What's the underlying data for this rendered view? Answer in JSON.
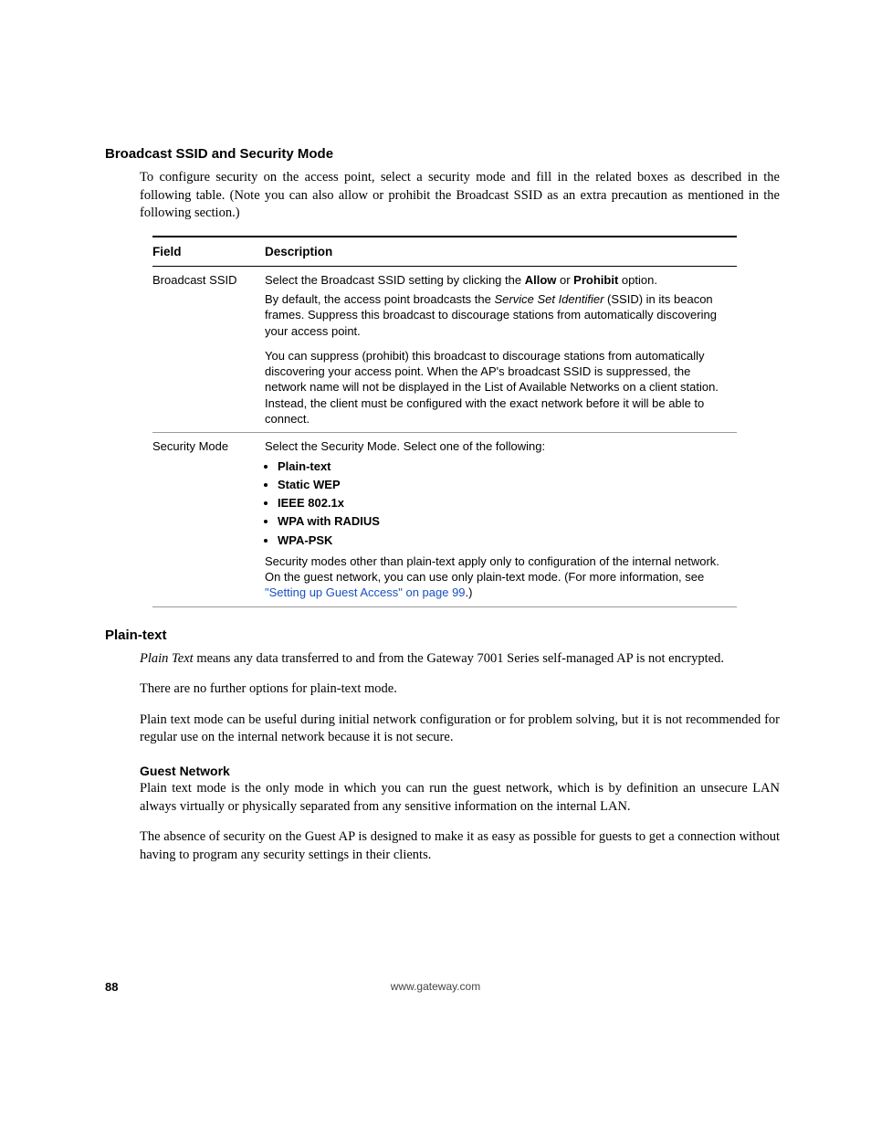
{
  "headings": {
    "h1": "Broadcast SSID and Security Mode",
    "h2": "Plain-text",
    "h3": "Guest Network"
  },
  "intro": {
    "p1": "To configure security on the access point, select a security mode and fill in the related boxes as described in the following table. (Note you can also allow or prohibit the Broadcast SSID as an extra precaution as mentioned in the following section.)"
  },
  "table": {
    "headers": {
      "field": "Field",
      "description": "Description"
    },
    "rows": {
      "broadcast_ssid": {
        "field": "Broadcast SSID",
        "line1_a": "Select the Broadcast SSID setting by clicking the ",
        "line1_allow": "Allow",
        "line1_b": " or ",
        "line1_prohibit": "Prohibit",
        "line1_c": " option.",
        "line2_a": "By default, the access point broadcasts the ",
        "line2_ssi": "Service Set Identifier",
        "line2_b": " (SSID) in its beacon frames. Suppress this broadcast to discourage stations from automatically discovering your access point.",
        "line3": "You can suppress (prohibit) this broadcast to discourage stations from automatically discovering your access point. When the AP's broadcast SSID is suppressed, the network name will not be displayed in the List of Available Networks on a client station. Instead, the client must be configured with the exact network before it will be able to connect."
      },
      "security_mode": {
        "field": "Security Mode",
        "line1": "Select the Security Mode. Select one of the following:",
        "modes": [
          "Plain-text",
          "Static WEP",
          "IEEE 802.1x",
          "WPA with RADIUS",
          "WPA-PSK"
        ],
        "line2_a": "Security modes other than plain-text apply only to configuration of the internal network. On the guest network, you can use only plain-text mode. (For more information, see ",
        "line2_link": "\"Setting up Guest Access\" on page 99",
        "line2_b": ".)"
      }
    }
  },
  "plaintext": {
    "p1_a": "Plain Text",
    "p1_b": " means any data transferred to and from the Gateway 7001 Series self-managed AP is not encrypted.",
    "p2": "There are no further options for plain-text mode.",
    "p3": "Plain text mode can be useful during initial network configuration or for problem solving, but it is not recommended for regular use on the internal network because it is not secure."
  },
  "guest": {
    "p1": "Plain text mode is the only mode in which you can run the guest network, which is by definition an unsecure LAN always virtually or physically separated from any sensitive information on the internal LAN.",
    "p2": "The absence of security on the Guest AP is designed to make it as easy as possible for guests to get a connection without having to program any security settings in their clients."
  },
  "footer": {
    "page": "88",
    "url": "www.gateway.com"
  }
}
